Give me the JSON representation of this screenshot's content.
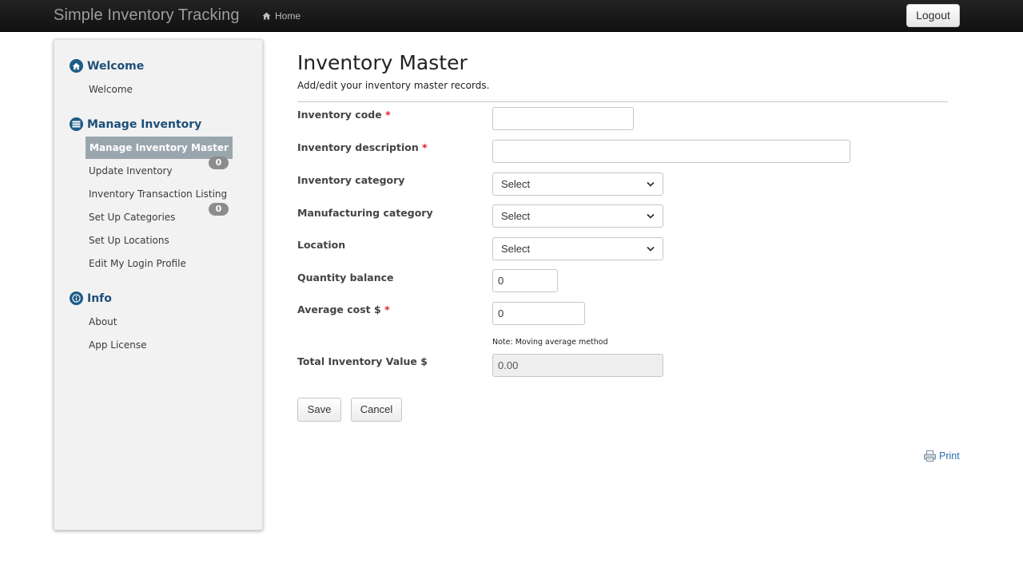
{
  "navbar": {
    "brand": "Simple Inventory Tracking",
    "home_label": "Home",
    "logout_label": "Logout"
  },
  "sidebar": {
    "sections": [
      {
        "title": "Welcome",
        "icon": "home-icon",
        "items": [
          "Welcome"
        ]
      },
      {
        "title": "Manage Inventory",
        "icon": "list-icon",
        "items": [
          "Manage Inventory Master",
          "Update Inventory",
          "Inventory Transaction Listing",
          "Set Up Categories",
          "Set Up Locations",
          "Edit My Login Profile"
        ]
      },
      {
        "title": "Info",
        "icon": "info-icon",
        "items": [
          "About",
          "App License"
        ]
      }
    ],
    "active_item": "Manage Inventory Master",
    "badges": [
      "0",
      "0"
    ]
  },
  "main": {
    "title": "Inventory Master",
    "subtitle": "Add/edit your inventory master records.",
    "fields": {
      "inventory_code": {
        "label": "Inventory code",
        "required": "*",
        "value": ""
      },
      "inventory_description": {
        "label": "Inventory description",
        "required": "*",
        "value": ""
      },
      "inventory_category": {
        "label": "Inventory category",
        "selected": "Select"
      },
      "manufacturing_category": {
        "label": "Manufacturing category",
        "selected": "Select"
      },
      "location": {
        "label": "Location",
        "selected": "Select"
      },
      "quantity_balance": {
        "label": "Quantity balance",
        "value": "0"
      },
      "average_cost": {
        "label": "Average cost $",
        "required": "*",
        "value": "0"
      },
      "total_value": {
        "label": "Total Inventory Value $",
        "value": "0.00"
      }
    },
    "note": "Note: Moving average method",
    "save_label": "Save",
    "cancel_label": "Cancel",
    "print_label": "Print"
  },
  "colors": {
    "navbar": "#1a1a1a",
    "section_title": "#1d4f7a",
    "active_item_bg": "#9aa6ad",
    "required": "#dd2222",
    "link": "#2a6fb0"
  }
}
